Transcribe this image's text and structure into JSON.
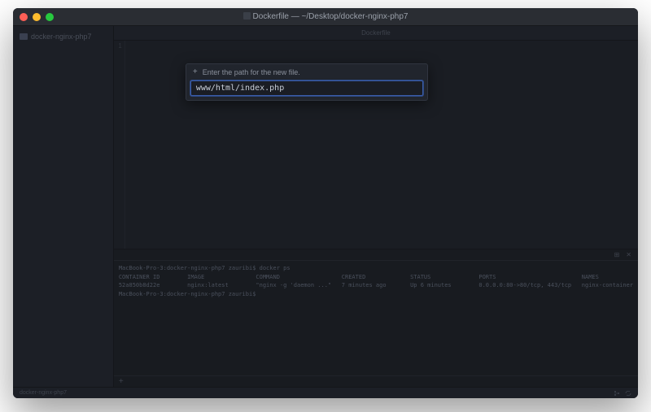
{
  "window": {
    "title": "Dockerfile — ~/Desktop/docker-nginx-php7"
  },
  "sidebar": {
    "root": "docker-nginx-php7"
  },
  "tabs": {
    "active": "Dockerfile"
  },
  "gutter": {
    "line1": "1"
  },
  "modal": {
    "prompt": "Enter the path for the new file.",
    "value": "www/html/index.php"
  },
  "terminal": {
    "line1": "MacBook-Pro-3:docker-nginx-php7 zauribi$ docker ps",
    "headers": "CONTAINER ID        IMAGE               COMMAND                  CREATED             STATUS              PORTS                         NAMES",
    "row1": "52a850b8d22e        nginx:latest        \"nginx -g 'daemon ...\"   7 minutes ago       Up 6 minutes        0.0.0.0:80->80/tcp, 443/tcp   nginx-container",
    "line2": "MacBook-Pro-3:docker-nginx-php7 zauribi$"
  },
  "statusbar": {
    "left": "docker-nginx-php7"
  }
}
